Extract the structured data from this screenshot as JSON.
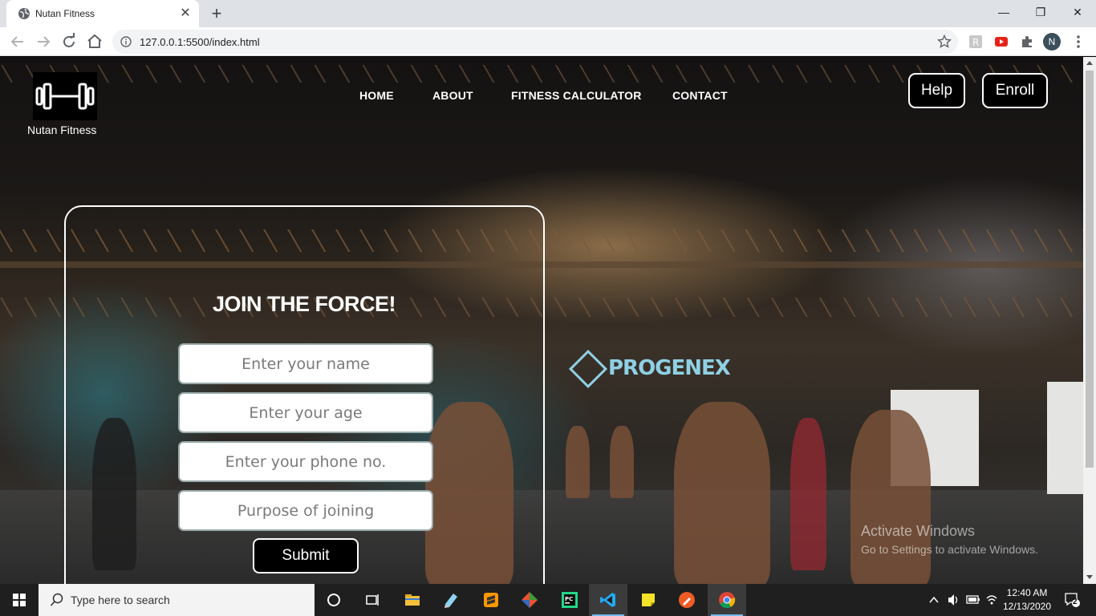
{
  "browser": {
    "tab_title": "Nutan Fitness",
    "url": "127.0.0.1:5500/index.html",
    "profile_initial": "N"
  },
  "site": {
    "brand": "Nutan Fitness",
    "nav": [
      "HOME",
      "ABOUT",
      "FITNESS CALCULATOR",
      "CONTACT"
    ],
    "help_label": "Help",
    "enroll_label": "Enroll",
    "gym_sign": "PROGENEX"
  },
  "form": {
    "title": "JOIN THE FORCE!",
    "name_placeholder": "Enter your name",
    "age_placeholder": "Enter your age",
    "phone_placeholder": "Enter your phone no.",
    "purpose_placeholder": "Purpose of joining",
    "submit_label": "Submit"
  },
  "watermark": {
    "line1": "Activate Windows",
    "line2": "Go to Settings to activate Windows."
  },
  "taskbar": {
    "search_placeholder": "Type here to search",
    "time": "12:40 AM",
    "date": "12/13/2020",
    "notification_count": "2"
  }
}
